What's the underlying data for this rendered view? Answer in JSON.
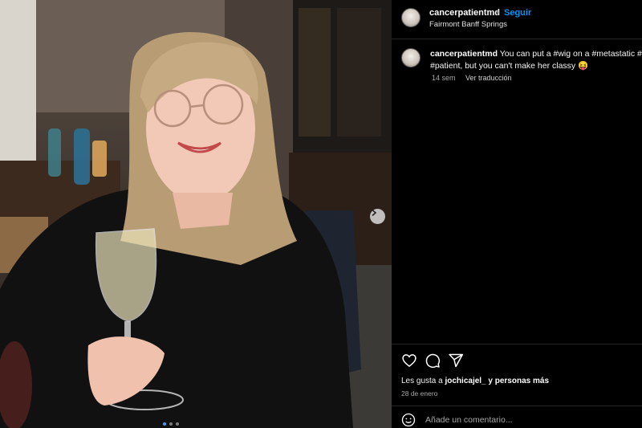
{
  "post": {
    "username": "cancerpatientmd",
    "location": "Fairmont Banff Springs",
    "follow_label": "Seguir",
    "separator": "•",
    "caption_user": "cancerpatientmd",
    "caption_text": " You can put a #wig on a #metastatic #sarcoma #patient, but you can't make her classy 😝",
    "age": "14 sem",
    "translate_label": "Ver traducción",
    "likes_prefix": "Les gusta a ",
    "likes_user": "jochicajel_",
    "likes_suffix": " y personas más",
    "date": "28 de enero",
    "comment_placeholder": "Añade un comentario..."
  },
  "carousel": {
    "current": 1,
    "total": 3
  },
  "icons": [
    "heart-icon",
    "comment-icon",
    "share-icon",
    "emoji-icon",
    "chevron-right-icon"
  ],
  "colors": {
    "background": "#000000",
    "accent": "#0095f6",
    "muted": "#a8a8a8"
  }
}
